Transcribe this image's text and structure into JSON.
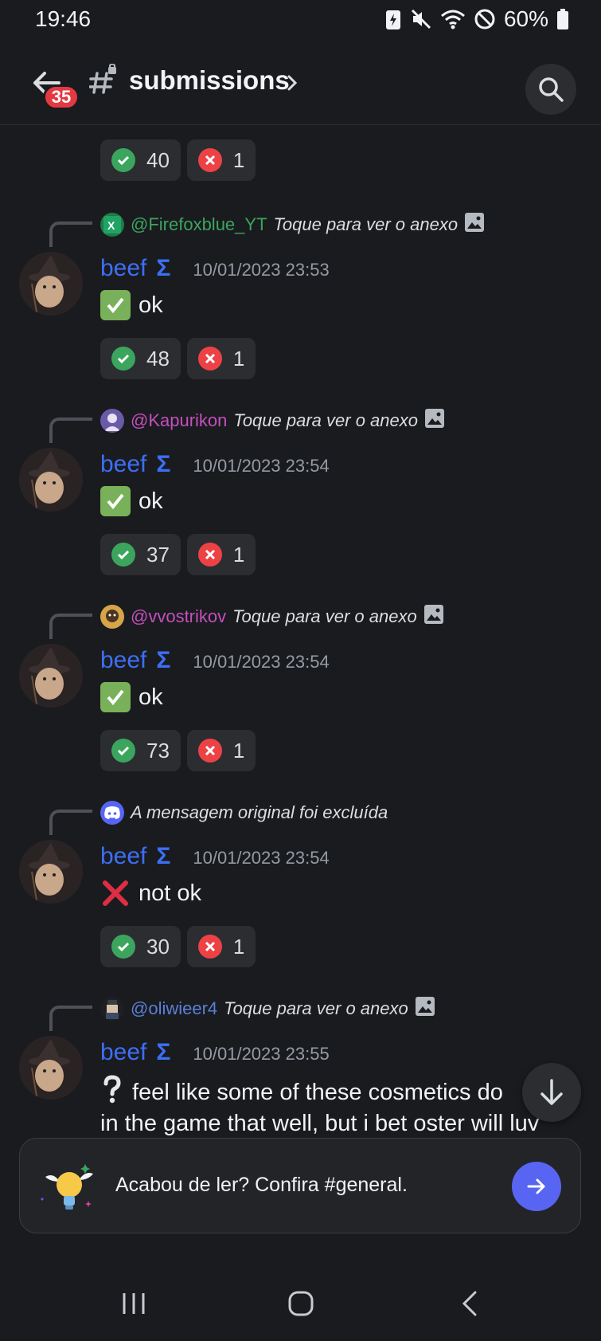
{
  "status": {
    "time": "19:46",
    "battery": "60%"
  },
  "header": {
    "badge": "35",
    "channel": "submissions"
  },
  "first_reactions": {
    "check": "40",
    "cross": "1"
  },
  "messages": [
    {
      "reply_user": "@Firefoxblue_YT",
      "reply_color": "#3ba55d",
      "reply_hint": "Toque para ver o anexo",
      "author": "beef",
      "badge": "Σ",
      "timestamp": "10/01/2023 23:53",
      "text": "ok",
      "emoji": "check",
      "check": "48",
      "cross": "1"
    },
    {
      "reply_user": "@Kapurikon",
      "reply_color": "#c44fbd",
      "reply_hint": "Toque para ver o anexo",
      "author": "beef",
      "badge": "Σ",
      "timestamp": "10/01/2023 23:54",
      "text": "ok",
      "emoji": "check",
      "check": "37",
      "cross": "1"
    },
    {
      "reply_user": "@vvostrikov",
      "reply_color": "#c44fbd",
      "reply_hint": "Toque para ver o anexo",
      "author": "beef",
      "badge": "Σ",
      "timestamp": "10/01/2023 23:54",
      "text": "ok",
      "emoji": "check",
      "check": "73",
      "cross": "1"
    },
    {
      "reply_user": "",
      "reply_color": "#dbdee1",
      "reply_hint": "A mensagem original foi excluída",
      "author": "beef",
      "badge": "Σ",
      "timestamp": "10/01/2023 23:54",
      "text": "not ok",
      "emoji": "cross",
      "check": "30",
      "cross": "1"
    },
    {
      "reply_user": "@oliwieer4",
      "reply_color": "#5a7fd6",
      "reply_hint": "Toque para ver o anexo",
      "author": "beef",
      "badge": "Σ",
      "timestamp": "10/01/2023 23:55",
      "text": "feel like some of these cosmetics do",
      "text2": "in the game that well, but i bet oster will luv"
    }
  ],
  "prompt": {
    "text": "Acabou de ler? Confira #general."
  },
  "icons": {
    "back": "back-arrow-icon",
    "channel": "text-channel-lock-icon",
    "search": "search-icon",
    "scroll": "arrow-down-icon",
    "go": "arrow-right-icon"
  }
}
